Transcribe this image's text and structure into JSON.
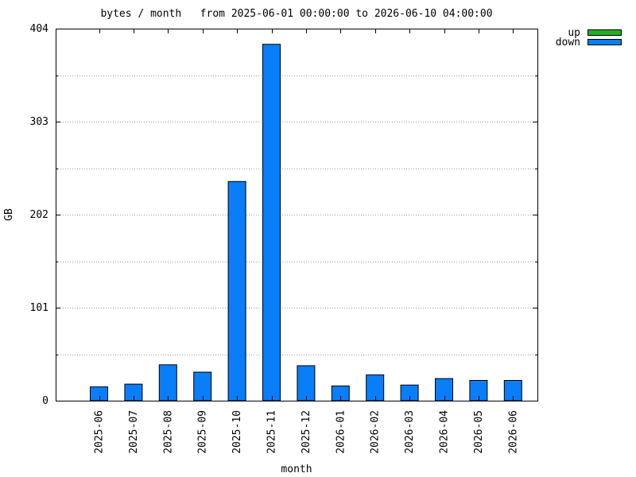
{
  "chart_data": {
    "type": "bar",
    "title": "bytes / month   from 2025-06-01 00:00:00 to 2026-06-10 04:00:00",
    "xlabel": "month",
    "ylabel": "GB",
    "categories": [
      "2025-06",
      "2025-07",
      "2025-08",
      "2025-09",
      "2025-10",
      "2025-11",
      "2025-12",
      "2026-01",
      "2026-02",
      "2026-03",
      "2026-04",
      "2026-05",
      "2026-06"
    ],
    "ylim": [
      0,
      404
    ],
    "yticks": [
      "0",
      "101",
      "202",
      "303",
      "404"
    ],
    "grid": true,
    "legend_position": "top-right",
    "series": [
      {
        "name": "up",
        "color": "#22b022",
        "values": [
          0,
          0,
          0,
          0,
          0,
          0,
          0,
          0,
          0,
          0,
          0,
          0,
          0
        ]
      },
      {
        "name": "down",
        "color": "#0a7df8",
        "values": [
          15,
          18,
          39,
          31,
          238,
          387,
          38,
          16,
          28,
          17,
          24,
          22,
          22
        ]
      }
    ]
  }
}
